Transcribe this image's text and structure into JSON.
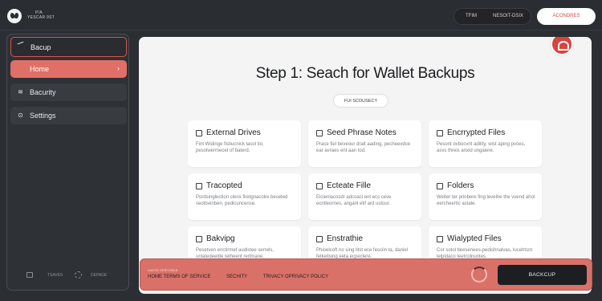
{
  "header": {
    "brand_line1": "P/A",
    "brand_line2": "YESCAR 9ST",
    "pill_left": "TFIM",
    "pill_right": "NESOIT-DSIX",
    "cta": "ACONDRES"
  },
  "sidebar": {
    "header_label": "Bacup",
    "items": [
      {
        "label": "Home",
        "icon": "home-icon",
        "active": true
      },
      {
        "label": "Bacurity",
        "icon": "database-icon",
        "active": false
      },
      {
        "label": "Settings",
        "icon": "lock-icon",
        "active": false
      }
    ],
    "footer_left": "TSAVES",
    "footer_right": "DEPADE"
  },
  "main": {
    "title": "Step 1: Seach for Wallet Backups",
    "sub_pill": "FUI SCOUSECY",
    "cards": [
      {
        "title": "External Drives",
        "desc": "Fint Widinge fistiucnick lacol tio, pesolwermecet of baterd."
      },
      {
        "title": "Seed Phrase Notes",
        "desc": "Prace fiel beveour drait aading, pecheevdce ear avraes ent aan tod."
      },
      {
        "title": "Encrrypted Files",
        "desc": "Pesont ovbocvrit adility, wist aping pvoes, asvs threis anxid ungaiere."
      },
      {
        "title": "Tracopted",
        "desc": "Pordsinglection clerix firetgnacolre beseted seottsenben, pedicuncense."
      },
      {
        "title": "Ecteate Fille",
        "desc": "Elcienlacosdr adcoacl ent ecs ceve ecntleornes, anganl etif ard ustour."
      },
      {
        "title": "Folders",
        "desc": "Welter ter prinbere fing leveihe the vvend ahol eercheertic astale."
      },
      {
        "title": "Bakvipg",
        "desc": "Pesetven enctirmef audistee serrels, unlatedeeitte tetheent rertmane."
      },
      {
        "title": "Enstrathie",
        "desc": "Phioelcoft no sing litst ece fesciin ta, daniel fetkellsing eeta ecpeclere."
      },
      {
        "title": "Wialypted Files",
        "desc": "Cor sotol tleesenees-pedishnalvas, lucehtsnt lelpidaco teetrcilnuntes."
      }
    ]
  },
  "bottombar": {
    "small_text": "LMOTE ORIFCSBLE",
    "link1": "HOME TERMS OF SERVICE",
    "link2": "SECHITY",
    "link3": "TRIVACY OPRIVACY POLICY",
    "button": "BACKCUP"
  },
  "colors": {
    "accent": "#e07067",
    "background": "#2b2e33",
    "panel": "#f4f4f5",
    "button_dark": "#1d1e21"
  }
}
